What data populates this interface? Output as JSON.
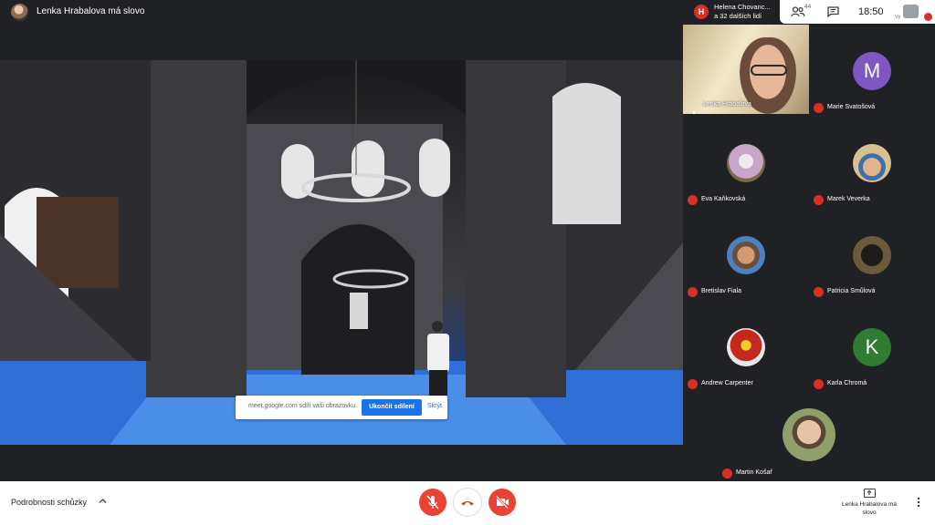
{
  "header": {
    "title": "Lenka Hrabalova má slovo",
    "join_badge": "H",
    "joined_line1": "Helena Chovanc...",
    "joined_line2": "a 32 dalších lidí",
    "people_count": "44",
    "time": "18:50",
    "self_label": "Vy"
  },
  "presentation": {
    "share_text": "meet.google.com sdílí vaši obrazovku.",
    "stop_label": "Ukončit sdílení",
    "hide_label": "Skrýt"
  },
  "participants": [
    {
      "name": "Lenka Hrabalova",
      "kind": "video"
    },
    {
      "name": "Marie Svatošová",
      "letter": "M",
      "color": "#7e57c2"
    },
    {
      "name": "Eva Kaňkovská",
      "color": "#d9c6de"
    },
    {
      "name": "Marek Veverka",
      "color": "#c8a070"
    },
    {
      "name": "Bretislav Fiala",
      "color": "#c9926b"
    },
    {
      "name": "Patricia Smůlová",
      "color": "#3a3328"
    },
    {
      "name": "Andrew Carpenter",
      "color": "#b7322a"
    },
    {
      "name": "Karla Chromá",
      "letter": "K",
      "color": "#2e7d32"
    },
    {
      "name": "Martin Košař",
      "color": "#8fa06a"
    }
  ],
  "bottom": {
    "details_label": "Podrobnosti schůzky",
    "present_label": "Lenka Hrabalova má slovo"
  },
  "icons": {
    "mic": "mic-off-icon",
    "hangup": "call-end-icon",
    "camera": "videocam-off-icon",
    "people": "people-icon",
    "chat": "chat-icon",
    "more": "more-vert-icon"
  }
}
